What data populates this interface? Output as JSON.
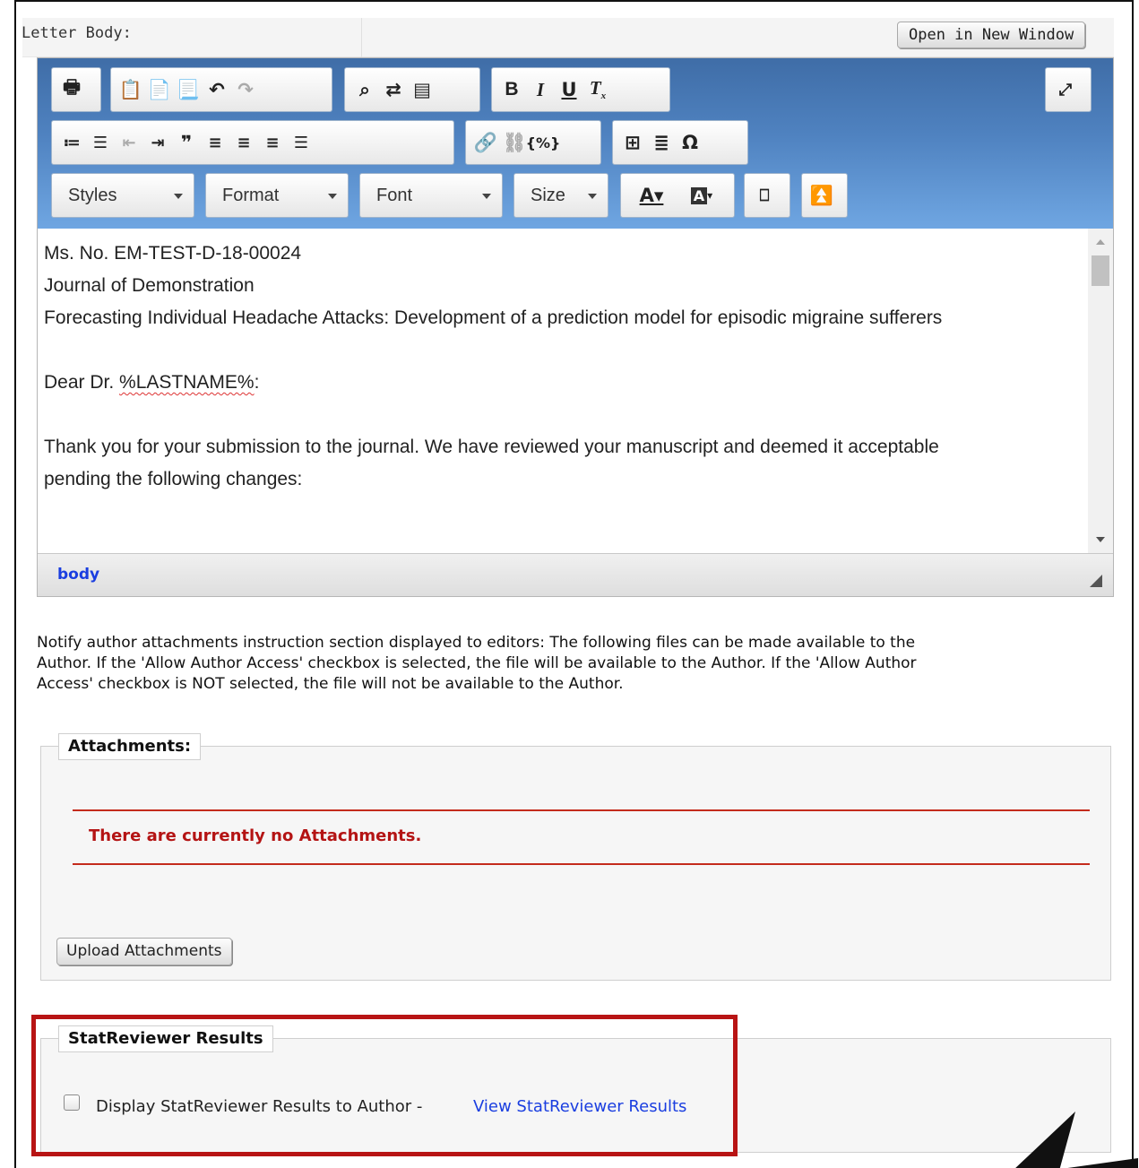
{
  "header": {
    "letter_body_label": "Letter Body:",
    "open_new_window": "Open in New Window"
  },
  "toolbar": {
    "style_combos": [
      "Styles",
      "Format",
      "Font",
      "Size"
    ]
  },
  "editor": {
    "lines": [
      "Ms. No. EM-TEST-D-18-00024",
      "Journal of Demonstration",
      "Forecasting Individual Headache Attacks: Development of a prediction model for episodic migraine sufferers"
    ],
    "greeting_prefix": "Dear Dr. ",
    "greeting_token": "%LASTNAME%",
    "greeting_suffix": ":",
    "body_line_1": "Thank you for your submission to the journal. We have reviewed your manuscript and deemed it acceptable",
    "body_line_2": "pending the following changes:",
    "element_path": "body"
  },
  "notify": {
    "line_1": "Notify author attachments instruction section displayed to editors: The following files can be made available to the",
    "line_2": "Author. If the 'Allow Author Access' checkbox is selected, the file will be available to the Author. If the 'Allow Author",
    "line_3": "Access' checkbox is NOT selected, the file will not be available to the Author."
  },
  "attachments": {
    "legend": "Attachments:",
    "empty_message": "There are currently no Attachments.",
    "upload_button": "Upload Attachments"
  },
  "statreviewer": {
    "legend": "StatReviewer Results",
    "checkbox_label": "Display StatReviewer Results to Author -",
    "checked": false,
    "view_link": "View StatReviewer Results"
  },
  "colors": {
    "toolbar_top": "#3f6da7",
    "toolbar_bottom": "#6fa6e2",
    "highlight_border": "#b81414",
    "error_text": "#b41414",
    "link": "#1a3ee0"
  }
}
